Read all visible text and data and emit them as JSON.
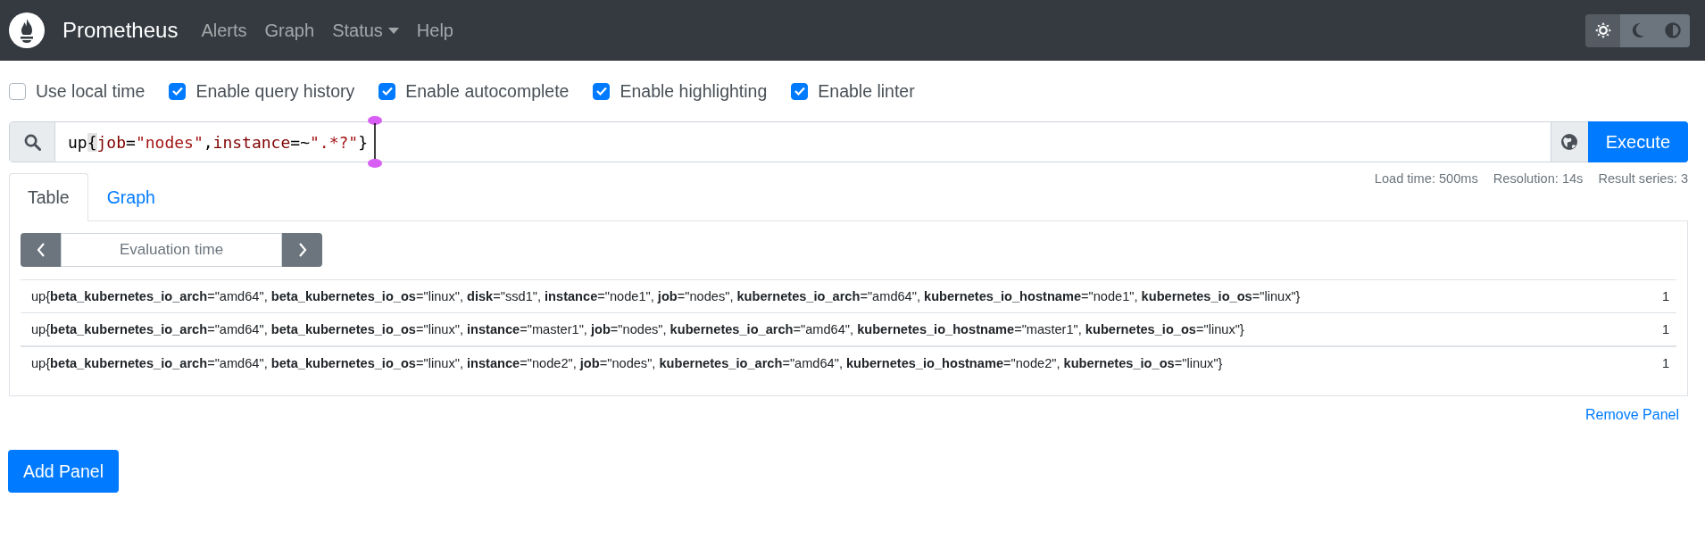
{
  "navbar": {
    "brand": "Prometheus",
    "items": [
      {
        "label": "Alerts",
        "dropdown": false
      },
      {
        "label": "Graph",
        "dropdown": false
      },
      {
        "label": "Status",
        "dropdown": true
      },
      {
        "label": "Help",
        "dropdown": false
      }
    ],
    "theme_buttons": [
      {
        "kind": "light",
        "selected": true
      },
      {
        "kind": "dark",
        "selected": false
      },
      {
        "kind": "auto",
        "selected": false
      }
    ]
  },
  "options": [
    {
      "label": "Use local time",
      "checked": false
    },
    {
      "label": "Enable query history",
      "checked": true
    },
    {
      "label": "Enable autocomplete",
      "checked": true
    },
    {
      "label": "Enable highlighting",
      "checked": true
    },
    {
      "label": "Enable linter",
      "checked": true
    }
  ],
  "query": {
    "tokens": [
      {
        "kind": "metric",
        "text": "up"
      },
      {
        "kind": "brace",
        "text": "{"
      },
      {
        "kind": "label",
        "text": "job"
      },
      {
        "kind": "op",
        "text": "="
      },
      {
        "kind": "string",
        "text": "\"nodes\""
      },
      {
        "kind": "punct",
        "text": ","
      },
      {
        "kind": "label",
        "text": "instance"
      },
      {
        "kind": "op",
        "text": "=~"
      },
      {
        "kind": "string",
        "text": "\".*?\""
      },
      {
        "kind": "punct",
        "text": "}"
      }
    ],
    "execute": "Execute"
  },
  "stats": [
    "Load time: 500ms",
    "Resolution: 14s",
    "Result series: 3"
  ],
  "panel": {
    "tabs": [
      {
        "label": "Table",
        "selected": true
      },
      {
        "label": "Graph",
        "selected": false
      }
    ],
    "evaluation_time": {
      "placeholder": "Evaluation time"
    },
    "rows": [
      {
        "series": "up{**beta_kubernetes_io_arch**=\"amd64\", **beta_kubernetes_io_os**=\"linux\", **disk**=\"ssd1\", **instance**=\"node1\", **job**=\"nodes\", **kubernetes_io_arch**=\"amd64\", **kubernetes_io_hostname**=\"node1\", **kubernetes_io_os**=\"linux\"}",
        "value": "1"
      },
      {
        "series": "up{**beta_kubernetes_io_arch**=\"amd64\", **beta_kubernetes_io_os**=\"linux\", **instance**=\"master1\", **job**=\"nodes\", **kubernetes_io_arch**=\"amd64\", **kubernetes_io_hostname**=\"master1\", **kubernetes_io_os**=\"linux\"}",
        "value": "1"
      },
      {
        "series": "up{**beta_kubernetes_io_arch**=\"amd64\", **beta_kubernetes_io_os**=\"linux\", **instance**=\"node2\", **job**=\"nodes\", **kubernetes_io_arch**=\"amd64\", **kubernetes_io_hostname**=\"node2\", **kubernetes_io_os**=\"linux\"}",
        "value": "1"
      }
    ],
    "remove": "Remove Panel"
  },
  "add_panel": "Add Panel"
}
